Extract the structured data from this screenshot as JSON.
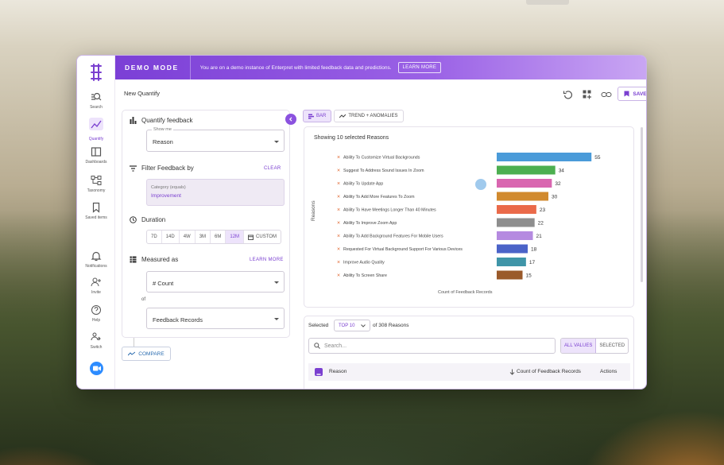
{
  "banner": {
    "mode": "DEMO MODE",
    "message": "You are on a demo instance of Enterpret with limited feedback data and predictions.",
    "learn_more": "LEARN MORE"
  },
  "sidebar": {
    "items": [
      {
        "label": "Search",
        "icon": "search-icon"
      },
      {
        "label": "Quantify",
        "icon": "chart-line-icon",
        "active": true
      },
      {
        "label": "Dashboards",
        "icon": "dashboard-icon"
      },
      {
        "label": "Taxonomy",
        "icon": "taxonomy-icon"
      },
      {
        "label": "Saved items",
        "icon": "bookmark-icon"
      },
      {
        "label": "Notifications",
        "icon": "bell-icon"
      },
      {
        "label": "Invite",
        "icon": "user-plus-icon"
      },
      {
        "label": "Help",
        "icon": "help-icon"
      },
      {
        "label": "Switch",
        "icon": "switch-icon"
      }
    ]
  },
  "toolbar": {
    "title": "New Quantify",
    "save_label": "SAVE"
  },
  "left": {
    "quantify_title": "Quantify feedback",
    "show_me_label": "Show me",
    "show_me_value": "Reason",
    "filter_title": "Filter Feedback by",
    "clear_label": "CLEAR",
    "filter_key": "Category (equals)",
    "filter_value": "Improvement",
    "duration_title": "Duration",
    "durations": [
      "7D",
      "14D",
      "4W",
      "3M",
      "6M",
      "12M",
      "CUSTOM"
    ],
    "duration_selected": "12M",
    "measured_title": "Measured as",
    "learn_more_label": "LEARN MORE",
    "measure_value": "# Count",
    "of_label": "of",
    "records_value": "Feedback Records",
    "compare_label": "COMPARE"
  },
  "view_tabs": [
    {
      "label": "BAR",
      "selected": true
    },
    {
      "label": "TREND + ANOMALIES",
      "selected": false
    }
  ],
  "chart_data": {
    "type": "bar",
    "title": "Showing 10 selected Reasons",
    "ylabel": "Reasons",
    "xlabel": "Count of Feedback Records",
    "categories": [
      "Ability To Customize Virtual Backgrounds",
      "Suggest To Address Sound Issues In Zoom",
      "Ability To Update App",
      "Ability To Add More Features To Zoom",
      "Ability To Have Meetings Longer Than 40 Minutes",
      "Ability To Improve Zoom App",
      "Ability To Add Background Features For Mobile Users",
      "Requested For Virtual Background Support For Various Devices",
      "Improve Audio Quality",
      "Ability To Screen Share"
    ],
    "values": [
      55,
      34,
      32,
      30,
      23,
      22,
      21,
      18,
      17,
      15
    ],
    "colors": [
      "#4a9bd9",
      "#4caf50",
      "#d966b0",
      "#d18a2e",
      "#ea6a4a",
      "#8e8e8e",
      "#b58ae0",
      "#4b63c8",
      "#3f95a8",
      "#9a5a2a"
    ],
    "xlim": [
      0,
      60
    ],
    "orientation": "horizontal"
  },
  "table": {
    "selected_label": "Selected",
    "top_value": "TOP 10",
    "of_reasons": "of 308 Reasons",
    "search_placeholder": "Search...",
    "toggle": [
      "ALL VALUES",
      "SELECTED"
    ],
    "columns": [
      "Reason",
      "Count of Feedback Records",
      "Actions"
    ]
  }
}
